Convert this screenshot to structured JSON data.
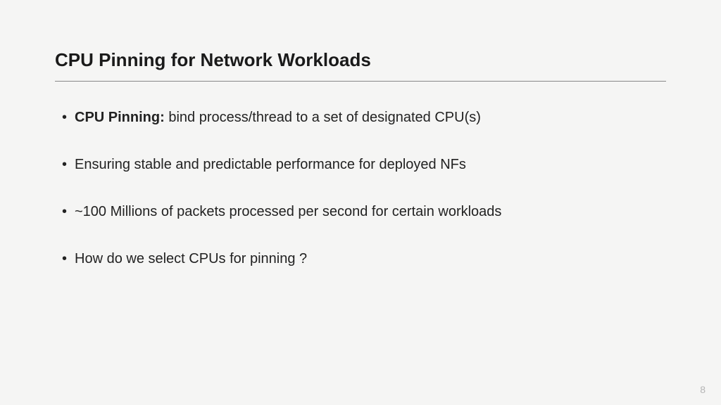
{
  "slide": {
    "title": "CPU Pinning for Network Workloads",
    "bullets": [
      {
        "lead": "CPU Pinning:",
        "rest": " bind process/thread to a set of designated CPU(s)"
      },
      {
        "lead": "",
        "rest": "Ensuring stable and predictable performance for deployed NFs"
      },
      {
        "lead": "",
        "rest": "~100 Millions of packets processed per second for certain workloads"
      },
      {
        "lead": "",
        "rest": "How do we select CPUs for pinning ?"
      }
    ],
    "page_number": "8"
  }
}
